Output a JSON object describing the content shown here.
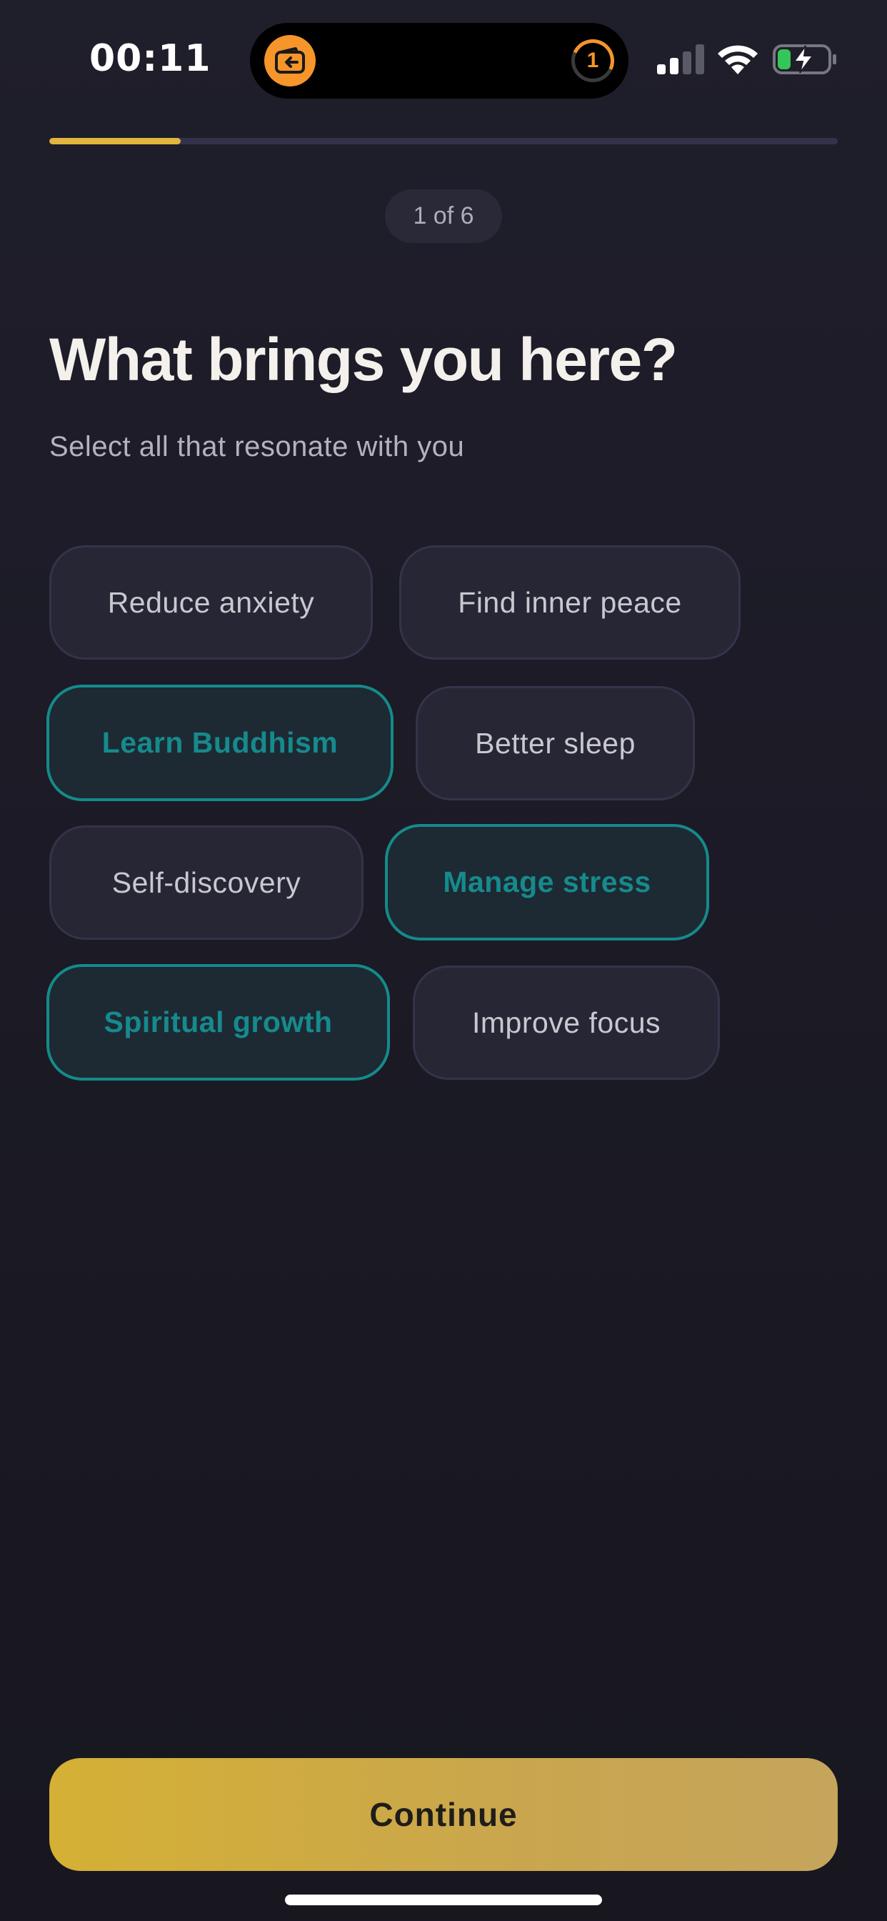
{
  "status_bar": {
    "time": "00:11",
    "timer_value": "1",
    "app_icon": "wallet-arrow-icon"
  },
  "onboarding": {
    "progress": 0.167,
    "step_label": "1 of 6",
    "title": "What brings you here?",
    "subtitle": "Select all that resonate with you",
    "options": [
      {
        "label": "Reduce anxiety",
        "selected": false
      },
      {
        "label": "Find inner peace",
        "selected": false
      },
      {
        "label": "Learn Buddhism",
        "selected": true
      },
      {
        "label": "Better sleep",
        "selected": false
      },
      {
        "label": "Self-discovery",
        "selected": false
      },
      {
        "label": "Manage stress",
        "selected": true
      },
      {
        "label": "Spiritual growth",
        "selected": true
      },
      {
        "label": "Improve focus",
        "selected": false
      }
    ],
    "continue_label": "Continue"
  },
  "colors": {
    "accent_gold": "#e2b53e",
    "selected_teal": "#158a8a",
    "background": "#1b1a25"
  }
}
